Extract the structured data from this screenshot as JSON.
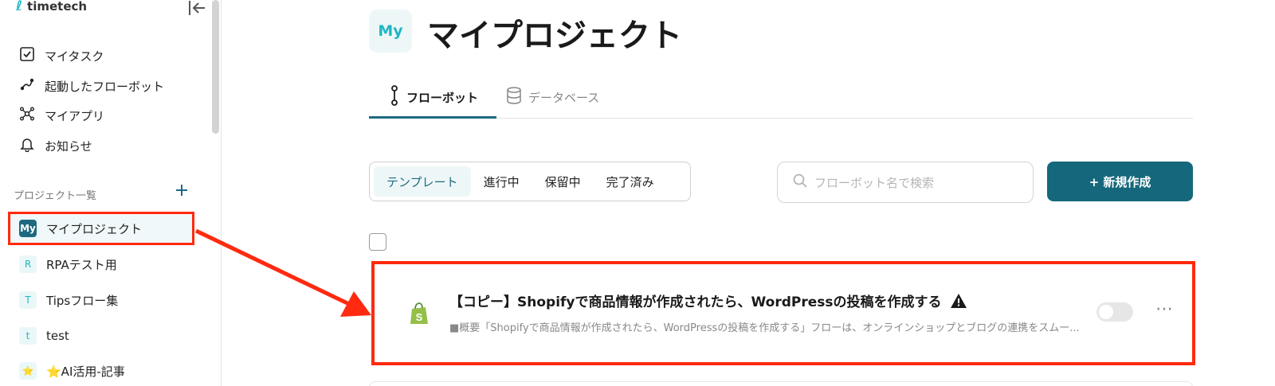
{
  "app": {
    "name": "timetech"
  },
  "sidebar": {
    "nav": [
      {
        "label": "マイタスク",
        "icon": "checkbox-icon"
      },
      {
        "label": "起動したフローボット",
        "icon": "flow-icon"
      },
      {
        "label": "マイアプリ",
        "icon": "apps-icon"
      },
      {
        "label": "お知らせ",
        "icon": "bell-icon"
      }
    ],
    "section_label": "プロジェクト一覧",
    "projects": [
      {
        "badge": "My",
        "label": "マイプロジェクト"
      },
      {
        "badge": "R",
        "label": "RPAテスト用"
      },
      {
        "badge": "T",
        "label": "Tipsフロー集"
      },
      {
        "badge": "t",
        "label": "test"
      },
      {
        "badge": "⭐",
        "label": "⭐AI活用-記事"
      }
    ]
  },
  "main": {
    "page_badge": "My",
    "title": "マイプロジェクト",
    "tabs": [
      {
        "label": "フローボット",
        "active": true
      },
      {
        "label": "データベース",
        "active": false
      }
    ],
    "filters": [
      {
        "label": "テンプレート",
        "active": true
      },
      {
        "label": "進行中"
      },
      {
        "label": "保留中"
      },
      {
        "label": "完了済み"
      }
    ],
    "search_placeholder": "フローボット名で検索",
    "new_button": "+ 新規作成",
    "flows": [
      {
        "title": "【コピー】Shopifyで商品情報が作成されたら、WordPressの投稿を作成する",
        "description": "■概要「Shopifyで商品情報が作成されたら、WordPressの投稿を作成する」フローは、オンラインショップとブログの連携をスムー...",
        "enabled": false,
        "warning": true,
        "app_icon": "shopify-icon"
      }
    ]
  },
  "colors": {
    "brand": "#1d6a80",
    "accent": "#20b7c4",
    "highlight": "#ff2a0f"
  }
}
